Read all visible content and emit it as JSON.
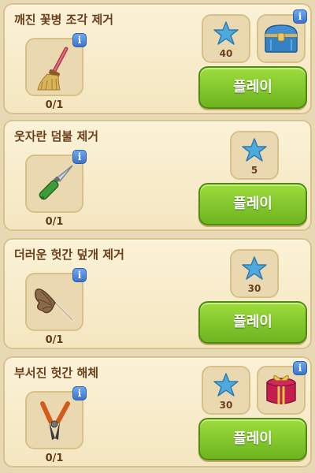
{
  "quests": [
    {
      "title": "깨진 꽃병 조각 제거",
      "item_icon": "broom-icon",
      "progress": "0/1",
      "reward_stars": "40",
      "reward_bonus_icon": "blue-chest-icon",
      "play_label": "플레이",
      "info_symbol": "i"
    },
    {
      "title": "웃자란 덤불 제거",
      "item_icon": "knife-icon",
      "progress": "0/1",
      "reward_stars": "5",
      "play_label": "플레이",
      "info_symbol": "i"
    },
    {
      "title": "더러운 헛간 덮개 제거",
      "item_icon": "feather-duster-icon",
      "progress": "0/1",
      "reward_stars": "30",
      "play_label": "플레이",
      "info_symbol": "i"
    },
    {
      "title": "부서진 헛간 해체",
      "item_icon": "bolt-cutter-icon",
      "progress": "0/1",
      "reward_stars": "30",
      "reward_bonus_icon": "gift-box-icon",
      "play_label": "플레이",
      "info_symbol": "i"
    }
  ],
  "colors": {
    "play_button": "#7cc526",
    "star": "#4ea9dd",
    "info_badge": "#4a82d6",
    "card_bg": "#f8eccb",
    "title_text": "#6b3f1d"
  }
}
